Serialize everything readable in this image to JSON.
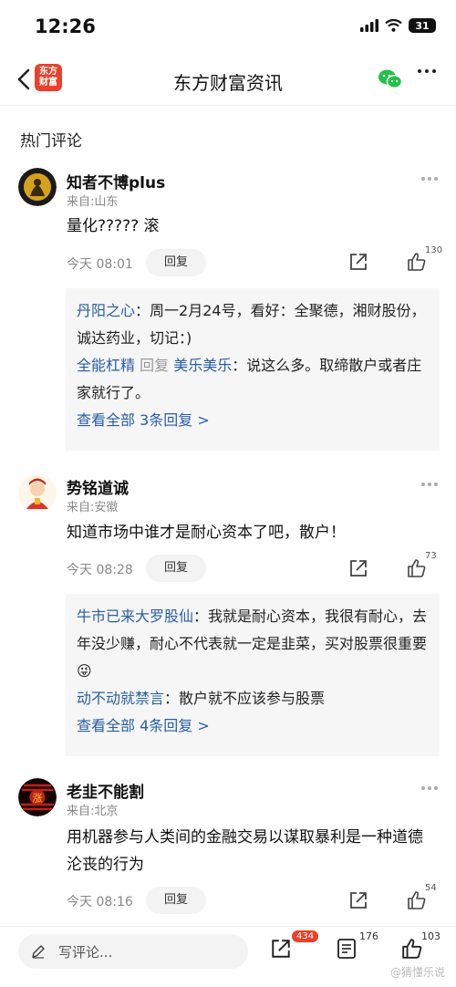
{
  "status": {
    "time": "12:26",
    "battery": "31"
  },
  "nav": {
    "title": "东方财富资讯",
    "logo": "东方\n财富"
  },
  "section_title": "热门评论",
  "comments": [
    {
      "user": "知者不博plus",
      "location": "来自:山东",
      "content": "量化?????  滚",
      "time": "今天 08:01",
      "reply_label": "回复",
      "likes": "130",
      "replies": [
        {
          "author": "丹阳之心",
          "sep": "：",
          "text": "周一2月24号，看好：全聚德，湘财股份，诚达药业，切记：)"
        },
        {
          "author": "全能杠精",
          "mid": " 回复 ",
          "target": "美乐美乐",
          "sep": "：",
          "text": "说这么多。取缔散户或者庄家就行了。"
        }
      ],
      "view_all": "查看全部 3条回复 >"
    },
    {
      "user": "势铭道诚",
      "location": "来自:安徽",
      "content": "知道市场中谁才是耐心资本了吧，散户！",
      "time": "今天 08:28",
      "reply_label": "回复",
      "likes": "73",
      "replies": [
        {
          "author": "牛市已来大罗股仙",
          "sep": "：",
          "text": "我就是耐心资本，我很有耐心，去年没少赚，耐心不代表就一定是韭菜，买对股票很重要😜"
        },
        {
          "author": "动不动就禁言",
          "sep": "：",
          "text": "散户就不应该参与股票"
        }
      ],
      "view_all": "查看全部 4条回复 >"
    },
    {
      "user": "老韭不能割",
      "location": "来自:北京",
      "content": "用机器参与人类间的金融交易以谋取暴利是一种道德沦丧的行为",
      "time": "今天 08:16",
      "reply_label": "回复",
      "likes": "54",
      "avatar_text": "涨"
    }
  ],
  "bottom": {
    "input_placeholder": "写评论...",
    "share_badge": "434",
    "comments_count": "176",
    "likes_count": "103",
    "watermark": "@猜懂乐说"
  },
  "colors": {
    "accent_blue": "#2a5ea7",
    "brand_red": "#e8412c",
    "wechat_green": "#22c04a"
  }
}
